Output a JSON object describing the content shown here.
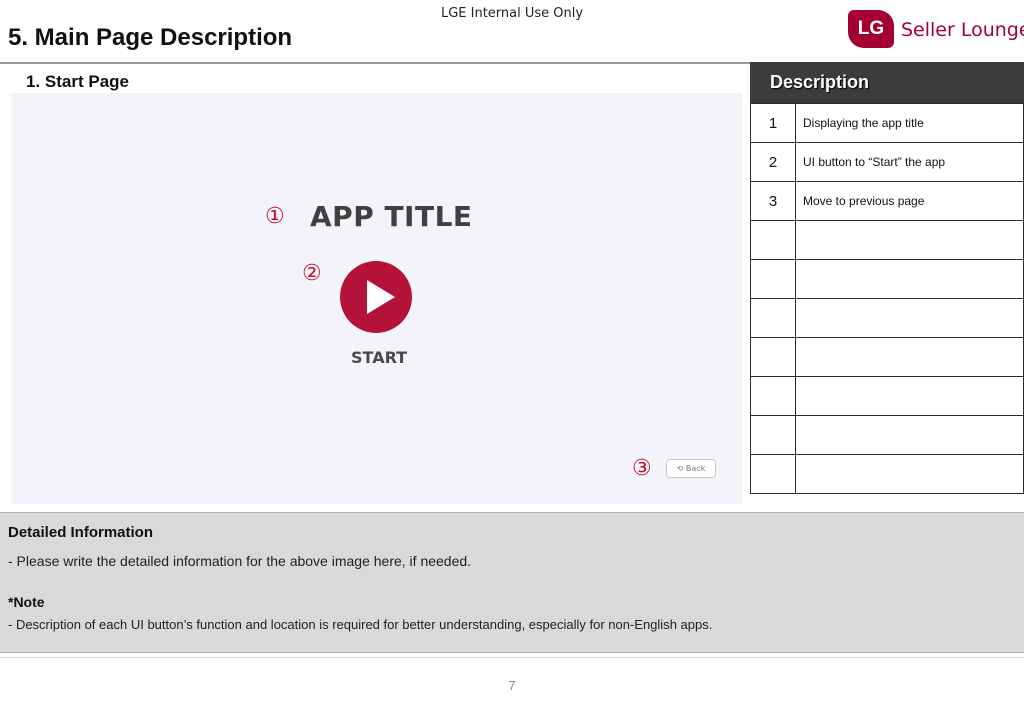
{
  "header": {
    "confidential": "LGE Internal Use Only",
    "page_title": "5. Main Page Description",
    "logo": {
      "badge": "LG",
      "text": "Seller Lounge",
      "brand_color": "#a50034"
    }
  },
  "section": {
    "title": "1. Start Page"
  },
  "mockup": {
    "markers": [
      "①",
      "②",
      "③"
    ],
    "app_title": "APP TITLE",
    "start_label": "START",
    "start_icon": "play-icon",
    "back_label": "⟲ Back",
    "accent_color": "#b5123a"
  },
  "description": {
    "title": "Description",
    "rows": [
      {
        "num": "1",
        "text": "Displaying the app title"
      },
      {
        "num": "2",
        "text": "UI button to “Start” the app"
      },
      {
        "num": "3",
        "text": "Move to previous page"
      },
      {
        "num": "",
        "text": ""
      },
      {
        "num": "",
        "text": ""
      },
      {
        "num": "",
        "text": ""
      },
      {
        "num": "",
        "text": ""
      },
      {
        "num": "",
        "text": ""
      },
      {
        "num": "",
        "text": ""
      },
      {
        "num": "",
        "text": ""
      }
    ]
  },
  "detail": {
    "title": "Detailed Information",
    "text": "- Please write the detailed information for the above image here, if needed.",
    "note_title": "*Note",
    "note_text": "- Description of each UI button’s function and location is required for better understanding, especially for non-English apps."
  },
  "footer": {
    "page_number": "7"
  }
}
